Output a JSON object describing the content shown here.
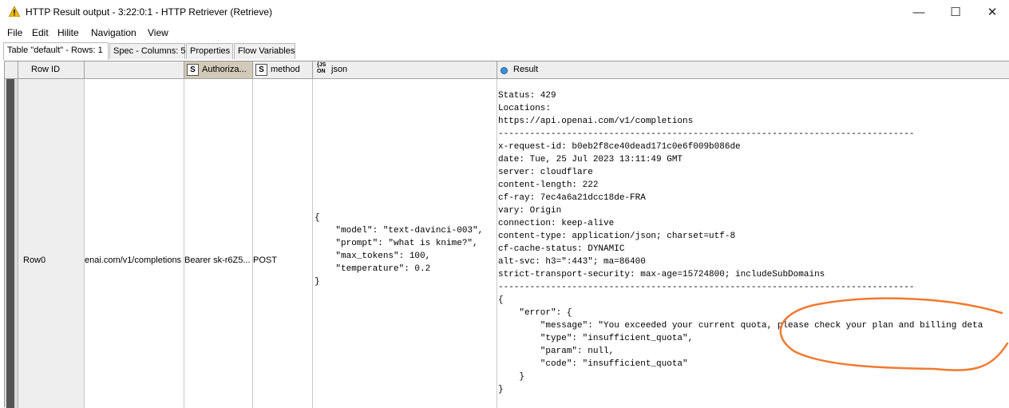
{
  "window": {
    "icon": "warning-triangle-icon",
    "title": "HTTP Result output - 3:22:0:1 - HTTP Retriever (Retrieve)",
    "controls": {
      "minimize": "—",
      "maximize": "☐",
      "close": "✕"
    }
  },
  "menu": [
    "File",
    "Edit",
    "Hilite",
    "Navigation",
    "View"
  ],
  "tabs": [
    "Table \"default\" - Rows: 1",
    "Spec - Columns: 5",
    "Properties",
    "Flow Variables"
  ],
  "table": {
    "headers": {
      "row_id": "Row ID",
      "url": "",
      "auth": "Authoriza...",
      "method": "method",
      "json": "json",
      "result": "Result"
    },
    "type_badges": {
      "string": "S",
      "json_top": "{JS",
      "json_bottom": "ON"
    },
    "row": {
      "row_id": "Row0",
      "url": "enai.com/v1/completions",
      "auth": "Bearer sk-r6Z5...",
      "method": "POST",
      "json": "{\n    \"model\": \"text-davinci-003\",\n    \"prompt\": \"what is knime?\",\n    \"max_tokens\": 100,\n    \"temperature\": 0.2\n}",
      "result": "Status: 429\nLocations:\nhttps://api.openai.com/v1/completions\n-------------------------------------------------------------------------------\nx-request-id: b0eb2f8ce40dead171c0e6f009b086de\ndate: Tue, 25 Jul 2023 13:11:49 GMT\nserver: cloudflare\ncontent-length: 222\ncf-ray: 7ec4a6a21dcc18de-FRA\nvary: Origin\nconnection: keep-alive\ncontent-type: application/json; charset=utf-8\ncf-cache-status: DYNAMIC\nalt-svc: h3=\":443\"; ma=86400\nstrict-transport-security: max-age=15724800; includeSubDomains\n-------------------------------------------------------------------------------\n{\n    \"error\": {\n        \"message\": \"You exceeded your current quota, please check your plan and billing deta\n        \"type\": \"insufficient_quota\",\n        \"param\": null,\n        \"code\": \"insufficient_quota\"\n    }\n}"
    }
  },
  "colors": {
    "annotation": "#f07a30",
    "result_dot": "#3b8fd9",
    "header_bg": "#eeeeee"
  }
}
